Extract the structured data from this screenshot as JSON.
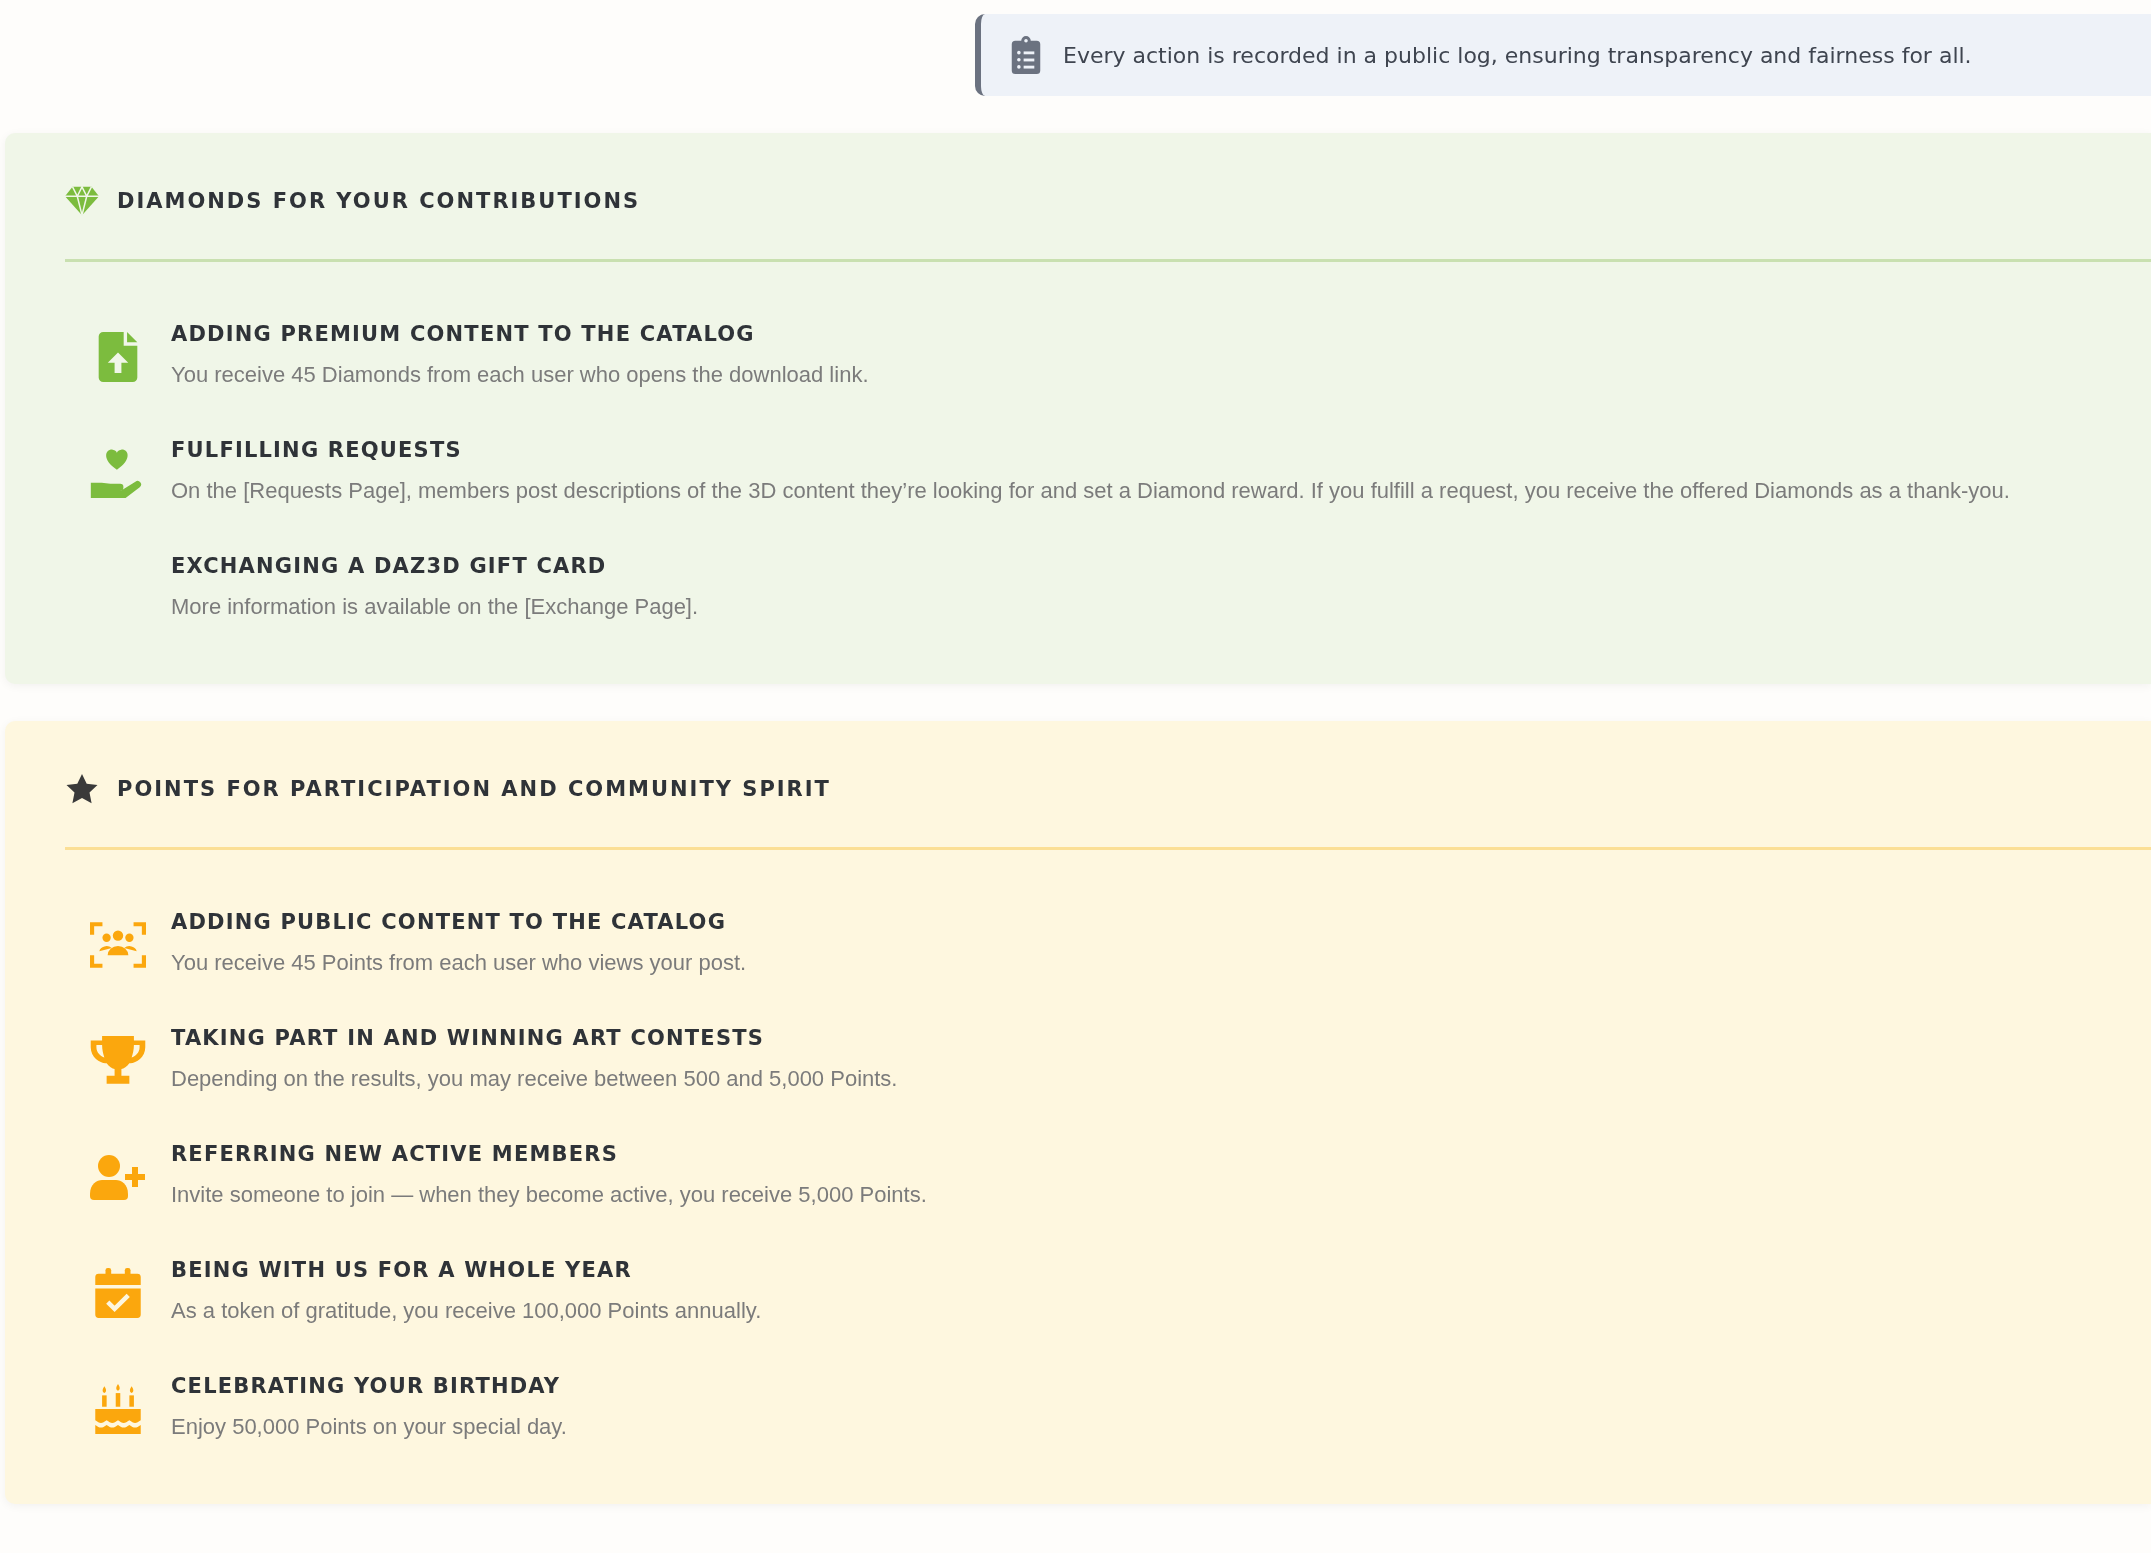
{
  "notice": {
    "text": "Every action is recorded in a public log, ensuring transparency and fairness for all."
  },
  "sections": [
    {
      "kind": "diamonds",
      "title": "DIAMONDS FOR YOUR CONTRIBUTIONS",
      "items": [
        {
          "kind": "file-upload",
          "title": "ADDING PREMIUM CONTENT TO THE CATALOG",
          "text": "You receive 45 Diamonds from each user who opens the download link."
        },
        {
          "kind": "hand-heart",
          "title": "FULFILLING REQUESTS",
          "text": "On the [Requests Page], members post descriptions of the 3D content they’re looking for and set a Diamond reward. If you fulfill a request, you receive the offered Diamonds as a thank-you."
        },
        {
          "kind": "plain",
          "title": "EXCHANGING A DAZ3D GIFT CARD",
          "text": "More information is available on the [Exchange Page]."
        }
      ]
    },
    {
      "kind": "points",
      "title": "POINTS FOR PARTICIPATION AND COMMUNITY SPIRIT",
      "items": [
        {
          "kind": "people-frame",
          "title": "ADDING PUBLIC CONTENT TO THE CATALOG",
          "text": "You receive 45 Points from each user who views your post."
        },
        {
          "kind": "trophy",
          "title": "TAKING PART IN AND WINNING ART CONTESTS",
          "text": "Depending on the results, you may receive between 500 and 5,000 Points."
        },
        {
          "kind": "user-plus",
          "title": "REFERRING NEW ACTIVE MEMBERS",
          "text": "Invite someone to join — when they become active, you receive 5,000 Points."
        },
        {
          "kind": "calendar-check",
          "title": "BEING WITH US FOR A WHOLE YEAR",
          "text": "As a token of gratitude, you receive 100,000 Points annually."
        },
        {
          "kind": "cake",
          "title": "CELEBRATING YOUR BIRTHDAY",
          "text": "Enjoy 50,000 Points on your special day."
        }
      ]
    }
  ]
}
